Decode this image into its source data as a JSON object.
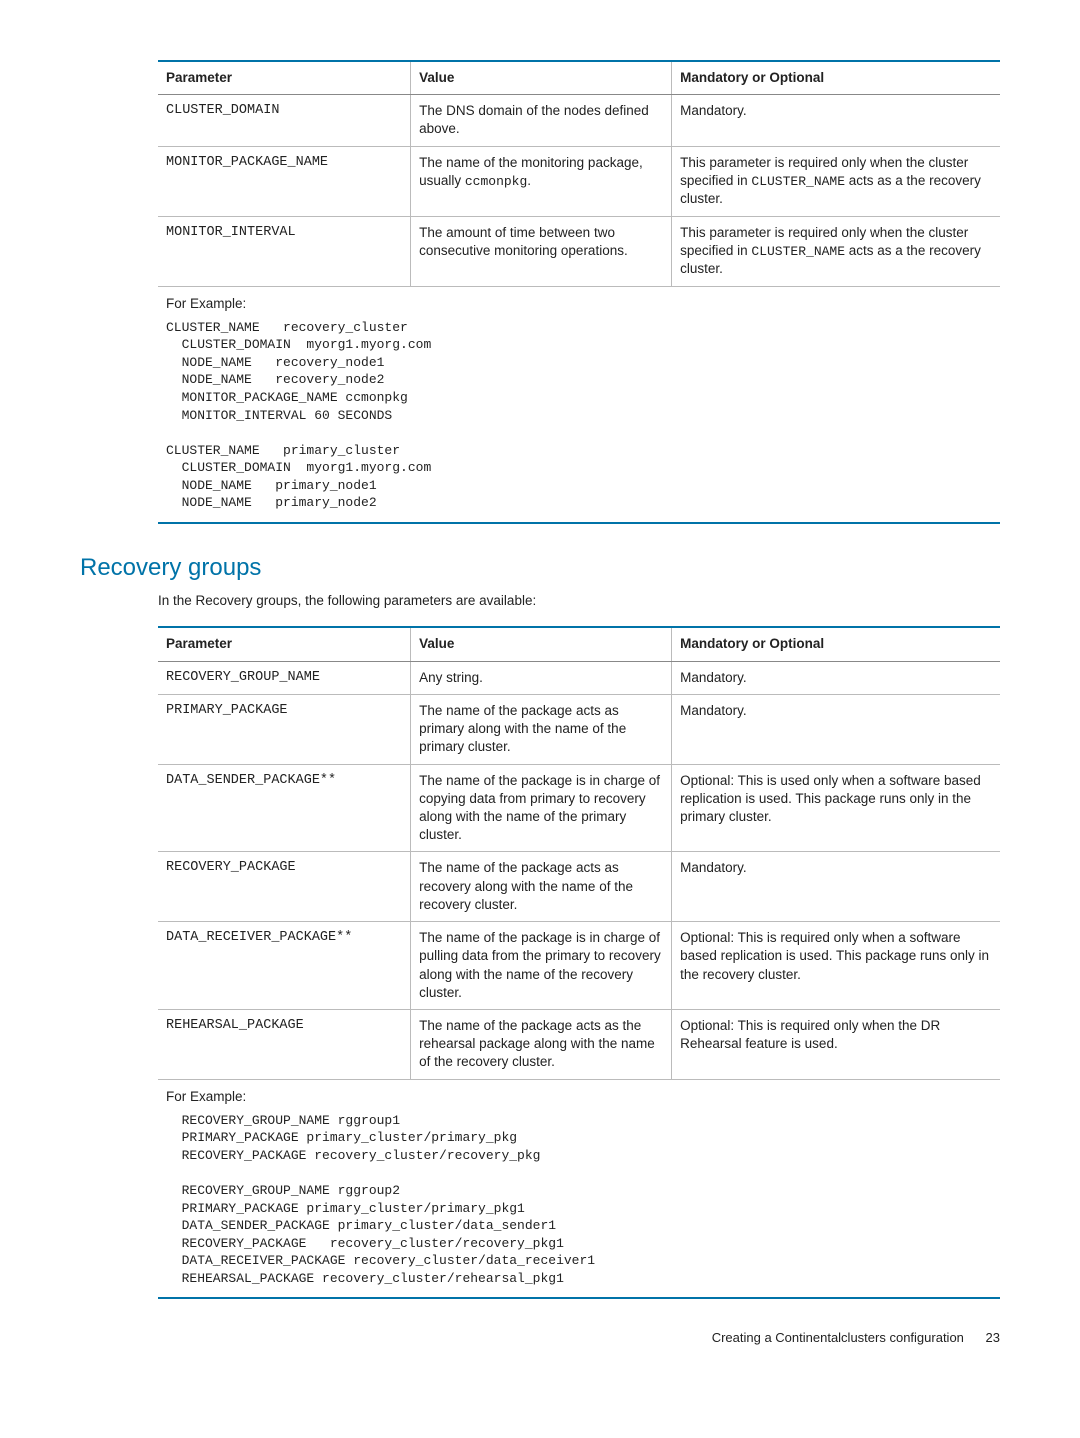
{
  "table1": {
    "headers": [
      "Parameter",
      "Value",
      "Mandatory or Optional"
    ],
    "rows": [
      {
        "param": "CLUSTER_DOMAIN",
        "value": "The DNS domain of the nodes defined above.",
        "mand": "Mandatory."
      },
      {
        "param": "MONITOR_PACKAGE_NAME",
        "value_pre": "The name of the monitoring package, usually ",
        "value_code": "ccmonpkg",
        "value_post": ".",
        "mand_pre": "This parameter is required only when the cluster specified in ",
        "mand_code": "CLUSTER_NAME",
        "mand_post": " acts as a the recovery cluster."
      },
      {
        "param": "MONITOR_INTERVAL",
        "value": "The amount of time between two consecutive monitoring operations.",
        "mand_pre": "This parameter is required only when the cluster specified in ",
        "mand_code": "CLUSTER_NAME",
        "mand_post": " acts as a the recovery cluster."
      }
    ],
    "example_label": "For Example:",
    "example_code": "CLUSTER_NAME   recovery_cluster\n  CLUSTER_DOMAIN  myorg1.myorg.com\n  NODE_NAME   recovery_node1\n  NODE_NAME   recovery_node2\n  MONITOR_PACKAGE_NAME ccmonpkg\n  MONITOR_INTERVAL 60 SECONDS\n\nCLUSTER_NAME   primary_cluster\n  CLUSTER_DOMAIN  myorg1.myorg.com\n  NODE_NAME   primary_node1\n  NODE_NAME   primary_node2"
  },
  "section2": {
    "title": "Recovery groups",
    "intro": "In the Recovery groups, the following parameters are available:"
  },
  "table2": {
    "headers": [
      "Parameter",
      "Value",
      "Mandatory or Optional"
    ],
    "rows": [
      {
        "param": "RECOVERY_GROUP_NAME",
        "value": "Any string.",
        "mand": "Mandatory."
      },
      {
        "param": "PRIMARY_PACKAGE",
        "value": "The name of the package acts as primary along with the name of the primary cluster.",
        "mand": "Mandatory."
      },
      {
        "param": "DATA_SENDER_PACKAGE**",
        "value": "The name of the package is in charge of copying data from primary to recovery along with the name of the primary cluster.",
        "mand": "Optional: This is used only when a software based replication is used. This package runs only in the primary cluster."
      },
      {
        "param": "RECOVERY_PACKAGE",
        "value": "The name of the package acts as recovery along with the name of the recovery cluster.",
        "mand": "Mandatory."
      },
      {
        "param": "DATA_RECEIVER_PACKAGE**",
        "value": "The name of the package is in charge of pulling data from the primary to recovery along with the name of the recovery cluster.",
        "mand": "Optional: This is required only when a software based replication is used. This package runs only in the recovery cluster."
      },
      {
        "param": "REHEARSAL_PACKAGE",
        "value": "The name of the package acts as the rehearsal package along with the name of the recovery cluster.",
        "mand": "Optional: This is required only when the DR Rehearsal feature is used."
      }
    ],
    "example_label": "For Example:",
    "example_code": "  RECOVERY_GROUP_NAME rggroup1\n  PRIMARY_PACKAGE primary_cluster/primary_pkg\n  RECOVERY_PACKAGE recovery_cluster/recovery_pkg\n\n  RECOVERY_GROUP_NAME rggroup2\n  PRIMARY_PACKAGE primary_cluster/primary_pkg1\n  DATA_SENDER_PACKAGE primary_cluster/data_sender1\n  RECOVERY_PACKAGE   recovery_cluster/recovery_pkg1\n  DATA_RECEIVER_PACKAGE recovery_cluster/data_receiver1\n  REHEARSAL_PACKAGE recovery_cluster/rehearsal_pkg1"
  },
  "footer": {
    "text": "Creating a Continentalclusters configuration",
    "page": "23"
  }
}
